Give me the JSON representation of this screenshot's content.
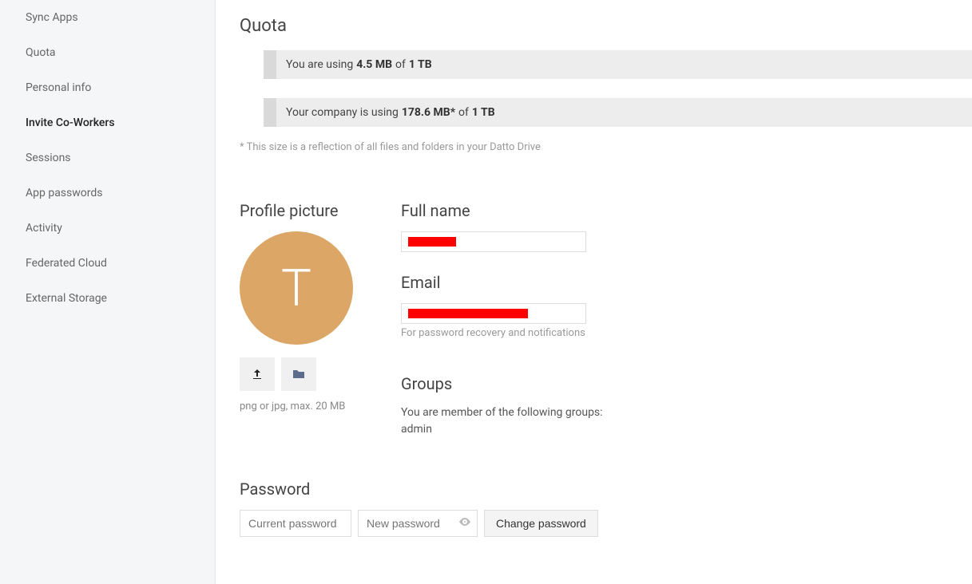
{
  "sidebar": {
    "items": [
      {
        "label": "Sync Apps",
        "active": false
      },
      {
        "label": "Quota",
        "active": false
      },
      {
        "label": "Personal info",
        "active": false
      },
      {
        "label": "Invite Co-Workers",
        "active": true
      },
      {
        "label": "Sessions",
        "active": false
      },
      {
        "label": "App passwords",
        "active": false
      },
      {
        "label": "Activity",
        "active": false
      },
      {
        "label": "Federated Cloud",
        "active": false
      },
      {
        "label": "External Storage",
        "active": false
      }
    ]
  },
  "quota": {
    "title": "Quota",
    "personal_prefix": "You are using",
    "personal_used": "4.5 MB",
    "personal_of": "of",
    "personal_total": "1 TB",
    "company_prefix": "Your company is using",
    "company_used": "178.6 MB*",
    "company_of": "of",
    "company_total": "1 TB",
    "footnote": "* This size is a reflection of all files and folders in your Datto Drive"
  },
  "profile": {
    "picture_title": "Profile picture",
    "avatar_letter": "T",
    "avatar_hint": "png or jpg, max. 20 MB",
    "fullname_title": "Full name",
    "fullname_value": "",
    "email_title": "Email",
    "email_value": "",
    "email_hint": "For password recovery and notifications",
    "groups_title": "Groups",
    "groups_text": "You are member of the following groups:",
    "groups_value": "admin"
  },
  "password": {
    "title": "Password",
    "current_placeholder": "Current password",
    "new_placeholder": "New password",
    "button_label": "Change password"
  }
}
